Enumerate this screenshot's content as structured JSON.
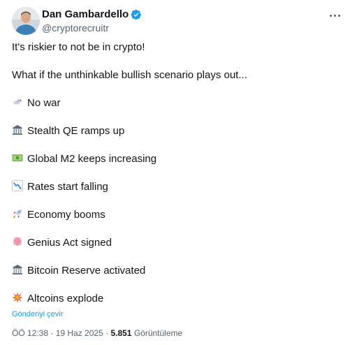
{
  "author": {
    "name": "Dan Gambardello",
    "handle": "@cryptorecruitr",
    "verified": true
  },
  "icons": {
    "more": "more-options-icon",
    "verified": "verified-badge-icon"
  },
  "tweet": {
    "intro": "It's riskier to not be in crypto!",
    "question": "What if the unthinkable bullish scenario plays out...",
    "items": [
      {
        "icon": "peace-dove-icon",
        "text": "No war"
      },
      {
        "icon": "classical-building-icon",
        "text": "Stealth QE ramps up"
      },
      {
        "icon": "dollar-banknote-icon",
        "text": "Global M2 keeps increasing"
      },
      {
        "icon": "chart-decreasing-icon",
        "text": "Rates start falling"
      },
      {
        "icon": "rocket-icon",
        "text": "Economy booms"
      },
      {
        "icon": "brain-icon",
        "text": "Genius Act signed"
      },
      {
        "icon": "bank-icon",
        "text": "Bitcoin Reserve activated"
      },
      {
        "icon": "collision-icon",
        "text": "Altcoins explode"
      }
    ]
  },
  "translate_label": "Gönderiyi çevir",
  "meta": {
    "time": "ÖÖ 12:38",
    "separator": " · ",
    "date": "19 Haz 2025",
    "views_count": "5.851",
    "views_label": "Görüntüleme"
  },
  "colors": {
    "text": "#0f1419",
    "secondary": "#536471",
    "link": "#1d9bf0",
    "verified": "#1d9bf0"
  }
}
